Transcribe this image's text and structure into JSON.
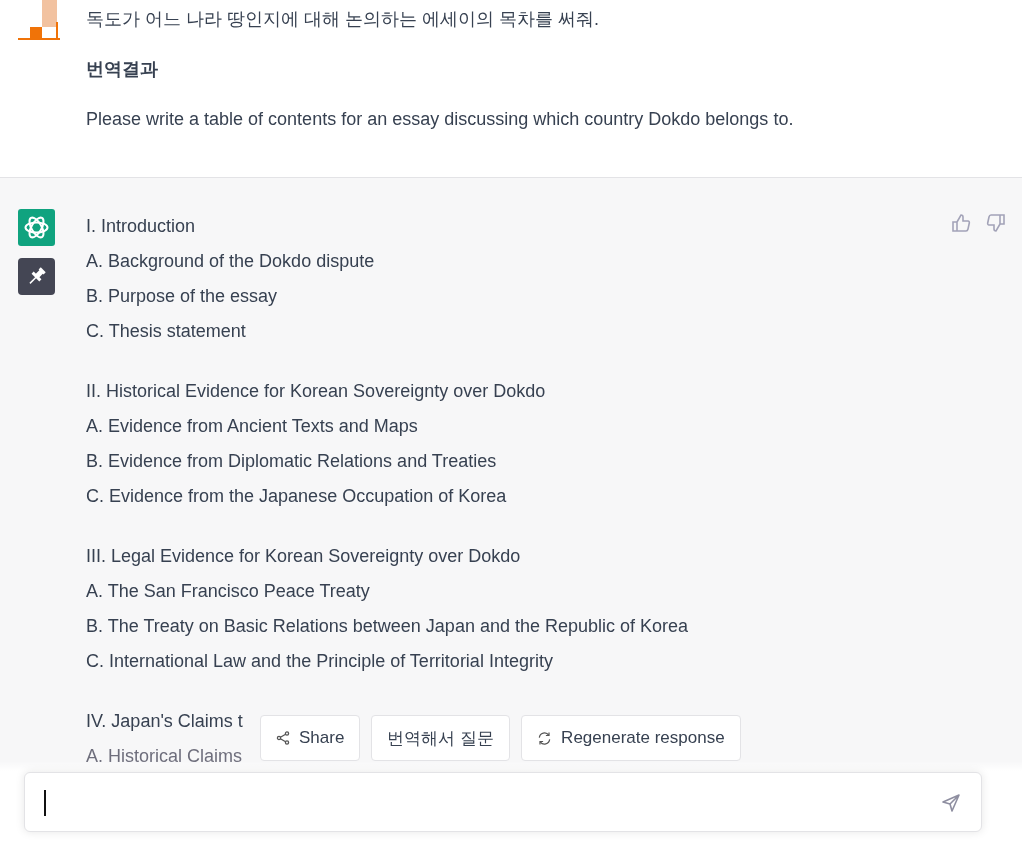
{
  "user_message": {
    "text": "독도가 어느 나라 땅인지에 대해 논의하는 에세이의 목차를 써줘.",
    "translation_heading": "번역결과",
    "translation": "Please write a table of contents for an essay discussing which country Dokdo belongs to."
  },
  "response": {
    "sections": [
      {
        "heading": "I. Introduction",
        "items": [
          "A. Background of the Dokdo dispute",
          "B. Purpose of the essay",
          "C. Thesis statement"
        ]
      },
      {
        "heading": "II. Historical Evidence for Korean Sovereignty over Dokdo",
        "items": [
          "A. Evidence from Ancient Texts and Maps",
          "B. Evidence from Diplomatic Relations and Treaties",
          "C. Evidence from the Japanese Occupation of Korea"
        ]
      },
      {
        "heading": "III. Legal Evidence for Korean Sovereignty over Dokdo",
        "items": [
          "A. The San Francisco Peace Treaty",
          "B. The Treaty on Basic Relations between Japan and the Republic of Korea",
          "C. International Law and the Principle of Territorial Integrity"
        ]
      },
      {
        "heading": "IV. Japan's Claims t",
        "items": [
          "A. Historical Claims"
        ]
      }
    ]
  },
  "actions": [
    {
      "kind": "share",
      "label": "Share"
    },
    {
      "kind": "plain",
      "label": "번역해서 질문"
    },
    {
      "kind": "regenerate",
      "label": "Regenerate response"
    }
  ],
  "composer": {
    "focused": true
  }
}
